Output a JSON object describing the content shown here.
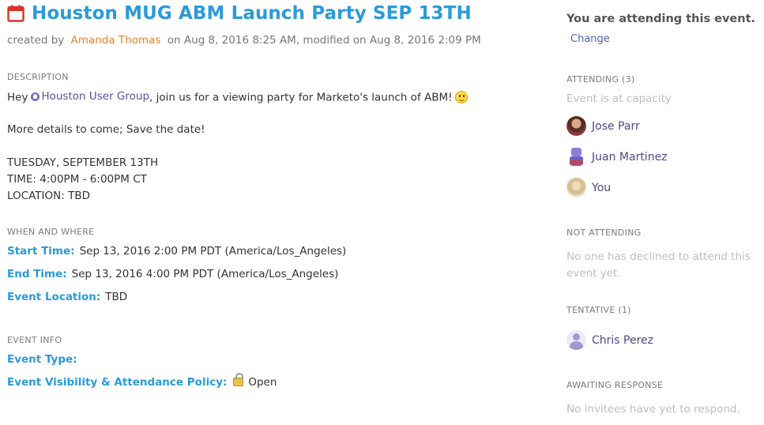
{
  "event": {
    "title": "Houston MUG ABM Launch Party SEP 13TH",
    "created_by_label": "created by",
    "author": "Amanda Thomas",
    "dates": "on Aug 8, 2016 8:25 AM, modified on Aug 8, 2016 2:09 PM"
  },
  "description": {
    "label": "DESCRIPTION",
    "line1_prefix": "Hey",
    "group_name": "Houston User Group",
    "line1_suffix": ", join us for a viewing party for Marketo's launch of ABM!",
    "line2": "More details to come; Save the date!",
    "line3": "TUESDAY, SEPTEMBER 13TH",
    "line4": "TIME: 4:00PM - 6:00PM CT",
    "line5": "LOCATION: TBD"
  },
  "when_where": {
    "label": "WHEN AND WHERE",
    "start_key": "Start Time:",
    "start_val": "Sep 13, 2016 2:00 PM PDT (America/Los_Angeles)",
    "end_key": "End Time:",
    "end_val": "Sep 13, 2016 4:00 PM PDT (America/Los_Angeles)",
    "location_key": "Event Location:",
    "location_val": "TBD"
  },
  "event_info": {
    "label": "EVENT INFO",
    "type_key": "Event Type:",
    "policy_key": "Event Visibility & Attendance Policy:",
    "policy_val": "Open"
  },
  "sidebar": {
    "status": "You are attending this event.",
    "change": "Change",
    "attending_label": "ATTENDING (3)",
    "capacity_note": "Event is at capacity",
    "attendees": [
      "Jose Parr",
      "Juan Martinez",
      "You"
    ],
    "not_attending_label": "NOT ATTENDING",
    "not_attending_note": "No one has declined to attend this event yet.",
    "tentative_label": "TENTATIVE (1)",
    "tentative": [
      "Chris Perez"
    ],
    "awaiting_label": "AWAITING RESPONSE",
    "awaiting_note": "No invitees have yet to respond."
  },
  "colors": {
    "title": "#2a9bd8",
    "author": "#e0852a",
    "link": "#5b4fa3",
    "calendar_icon": "#d9342b"
  }
}
